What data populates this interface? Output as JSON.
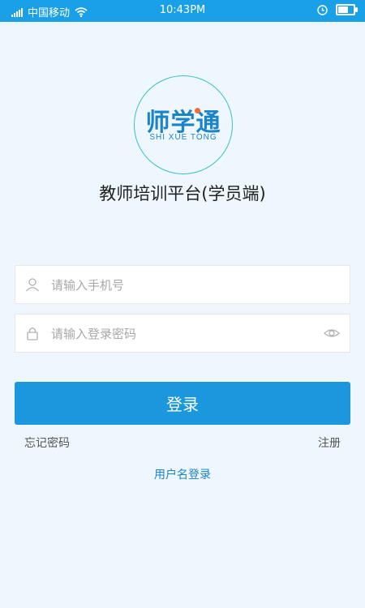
{
  "status_bar": {
    "carrier": "中国移动",
    "time": "10:43PM"
  },
  "logo": {
    "chinese": "师学通",
    "english": "SHI XUE TONG"
  },
  "app_title": "教师培训平台(学员端)",
  "form": {
    "phone_placeholder": "请输入手机号",
    "password_placeholder": "请输入登录密码",
    "login_label": "登录",
    "forgot_label": "忘记密码",
    "register_label": "注册",
    "username_login_label": "用户名登录"
  },
  "colors": {
    "status_bar": "#1aa0e6",
    "primary": "#1b97dd",
    "link": "#1b84c8",
    "background": "#eef7fd"
  }
}
